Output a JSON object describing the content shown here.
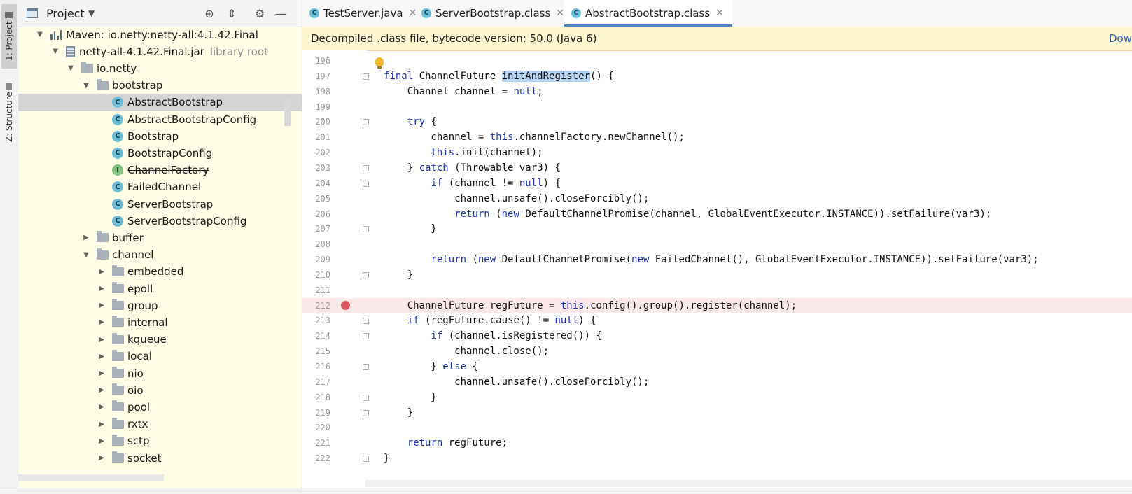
{
  "sidebar_stripe": {
    "project_tab": "1: Project",
    "structure_tab": "Z: Structure"
  },
  "project_panel": {
    "title": "Project",
    "tree": [
      {
        "label": "Maven: io.netty:netty-all:4.1.42.Final",
        "icon": "maven-library-icon",
        "expanded": true
      },
      {
        "label": "netty-all-4.1.42.Final.jar",
        "hint": "library root",
        "icon": "jar-icon",
        "expanded": true
      },
      {
        "label": "io.netty",
        "icon": "package-icon",
        "expanded": true
      },
      {
        "label": "bootstrap",
        "icon": "package-icon",
        "expanded": true
      },
      {
        "label": "AbstractBootstrap",
        "icon": "class-icon",
        "selected": true
      },
      {
        "label": "AbstractBootstrapConfig",
        "icon": "class-icon"
      },
      {
        "label": "Bootstrap",
        "icon": "class-icon"
      },
      {
        "label": "BootstrapConfig",
        "icon": "class-icon"
      },
      {
        "label": "ChannelFactory",
        "icon": "interface-icon",
        "deprecated": true
      },
      {
        "label": "FailedChannel",
        "icon": "class-icon"
      },
      {
        "label": "ServerBootstrap",
        "icon": "class-icon"
      },
      {
        "label": "ServerBootstrapConfig",
        "icon": "class-icon"
      },
      {
        "label": "buffer",
        "icon": "package-icon",
        "expanded": false
      },
      {
        "label": "channel",
        "icon": "package-icon",
        "expanded": true
      },
      {
        "label": "embedded",
        "icon": "package-icon",
        "expanded": false
      },
      {
        "label": "epoll",
        "icon": "package-icon",
        "expanded": false
      },
      {
        "label": "group",
        "icon": "package-icon",
        "expanded": false
      },
      {
        "label": "internal",
        "icon": "package-icon",
        "expanded": false
      },
      {
        "label": "kqueue",
        "icon": "package-icon",
        "expanded": false
      },
      {
        "label": "local",
        "icon": "package-icon",
        "expanded": false
      },
      {
        "label": "nio",
        "icon": "package-icon",
        "expanded": false
      },
      {
        "label": "oio",
        "icon": "package-icon",
        "expanded": false
      },
      {
        "label": "pool",
        "icon": "package-icon",
        "expanded": false
      },
      {
        "label": "rxtx",
        "icon": "package-icon",
        "expanded": false
      },
      {
        "label": "sctp",
        "icon": "package-icon",
        "expanded": false
      },
      {
        "label": "socket",
        "icon": "package-icon",
        "expanded": false
      }
    ]
  },
  "editor": {
    "tabs": [
      {
        "label": "TestServer.java",
        "active": false
      },
      {
        "label": "ServerBootstrap.class",
        "active": false
      },
      {
        "label": "AbstractBootstrap.class",
        "active": true
      }
    ],
    "banner_text": "Decompiled .class file, bytecode version: 50.0 (Java 6)",
    "banner_link": "Dow",
    "breakpoint_line": "212",
    "lines": [
      {
        "num": "196",
        "code": ""
      },
      {
        "num": "197",
        "code": "final ChannelFuture initAndRegister() {"
      },
      {
        "num": "198",
        "code": "    Channel channel = null;"
      },
      {
        "num": "199",
        "code": ""
      },
      {
        "num": "200",
        "code": "    try {"
      },
      {
        "num": "201",
        "code": "        channel = this.channelFactory.newChannel();"
      },
      {
        "num": "202",
        "code": "        this.init(channel);"
      },
      {
        "num": "203",
        "code": "    } catch (Throwable var3) {"
      },
      {
        "num": "204",
        "code": "        if (channel != null) {"
      },
      {
        "num": "205",
        "code": "            channel.unsafe().closeForcibly();"
      },
      {
        "num": "206",
        "code": "            return (new DefaultChannelPromise(channel, GlobalEventExecutor.INSTANCE)).setFailure(var3);"
      },
      {
        "num": "207",
        "code": "        }"
      },
      {
        "num": "208",
        "code": ""
      },
      {
        "num": "209",
        "code": "        return (new DefaultChannelPromise(new FailedChannel(), GlobalEventExecutor.INSTANCE)).setFailure(var3);"
      },
      {
        "num": "210",
        "code": "    }"
      },
      {
        "num": "211",
        "code": ""
      },
      {
        "num": "212",
        "code": "    ChannelFuture regFuture = this.config().group().register(channel);"
      },
      {
        "num": "213",
        "code": "    if (regFuture.cause() != null) {"
      },
      {
        "num": "214",
        "code": "        if (channel.isRegistered()) {"
      },
      {
        "num": "215",
        "code": "            channel.close();"
      },
      {
        "num": "216",
        "code": "        } else {"
      },
      {
        "num": "217",
        "code": "            channel.unsafe().closeForcibly();"
      },
      {
        "num": "218",
        "code": "        }"
      },
      {
        "num": "219",
        "code": "    }"
      },
      {
        "num": "220",
        "code": ""
      },
      {
        "num": "221",
        "code": "    return regFuture;"
      },
      {
        "num": "222",
        "code": "}"
      }
    ]
  },
  "colors": {
    "keyword": "#1a32b4",
    "identifier_highlight": "#b6d4f2",
    "breakpoint": "#db5860",
    "panel_background": "#fffde6",
    "banner_background": "#fff6d2"
  }
}
